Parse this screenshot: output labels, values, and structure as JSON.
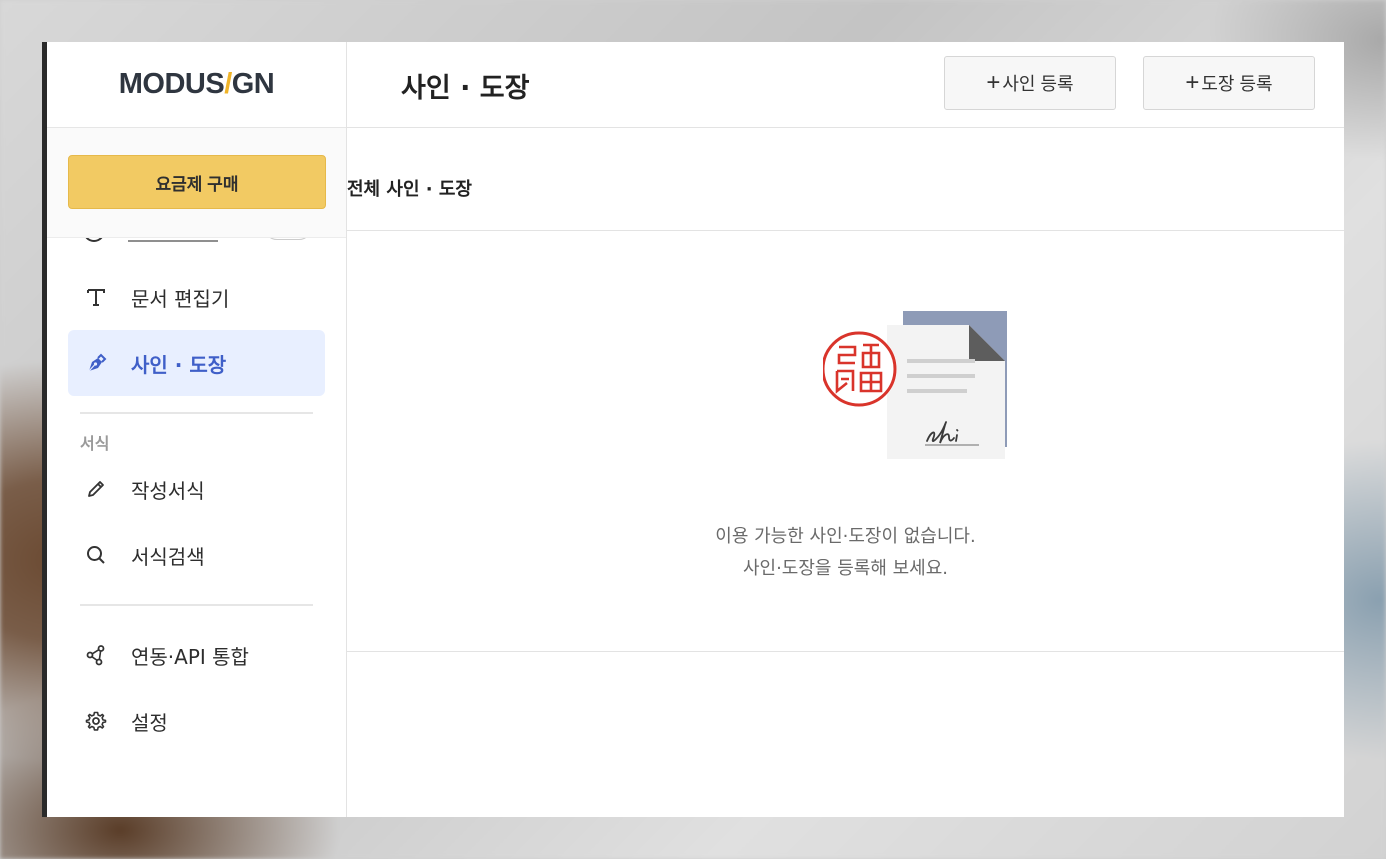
{
  "brand": {
    "logo_left": "MODUS",
    "logo_slash": "/",
    "logo_right": "GN"
  },
  "sidebar": {
    "purchase_label": "요금제 구매",
    "items": [
      {
        "label": "문서 편집기",
        "icon": "text-icon"
      },
      {
        "label": "사인 · 도장",
        "icon": "pen-nib-icon",
        "active": true
      }
    ],
    "section_label": "서식",
    "section_items": [
      {
        "label": "작성서식",
        "icon": "pencil-icon"
      },
      {
        "label": "서식검색",
        "icon": "search-icon"
      }
    ],
    "bottom_items": [
      {
        "label": "연동·API 통합",
        "icon": "share-nodes-icon"
      },
      {
        "label": "설정",
        "icon": "gear-icon"
      }
    ]
  },
  "header": {
    "title": "사인 · 도장",
    "add_sign_label": "사인 등록",
    "add_stamp_label": "도장 등록",
    "plus": "+"
  },
  "content": {
    "section_title": "전체 사인 · 도장",
    "empty_line1": "이용 가능한 사인·도장이 없습니다.",
    "empty_line2": "사인·도장을 등록해 보세요."
  },
  "colors": {
    "accent_yellow": "#f2ca63",
    "active_blue": "#3f5fc8",
    "active_bg": "#e8efff",
    "stamp_red": "#d9342b"
  }
}
